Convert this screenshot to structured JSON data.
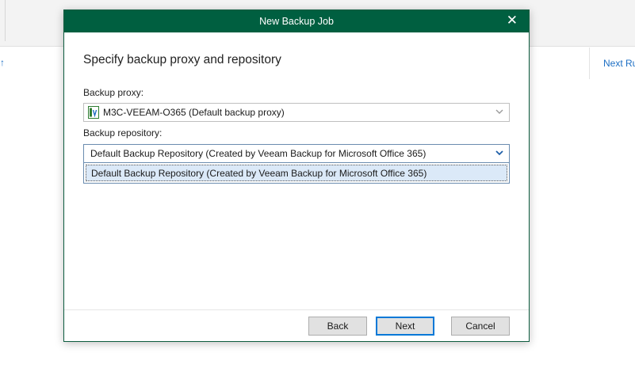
{
  "background": {
    "left_glyph": "↑",
    "column_header": "Next Ru"
  },
  "dialog": {
    "title": "New Backup Job",
    "close_glyph": "✕",
    "heading": "Specify backup proxy and repository",
    "proxy": {
      "label": "Backup proxy:",
      "value": "M3C-VEEAM-O365 (Default backup proxy)",
      "icon": "server-icon"
    },
    "repository": {
      "label": "Backup repository:",
      "value": "Default Backup Repository (Created by Veeam Backup for Microsoft Office 365)",
      "options": [
        "Default Backup Repository (Created by Veeam Backup for Microsoft Office 365)"
      ]
    },
    "buttons": {
      "back": "Back",
      "next": "Next",
      "cancel": "Cancel"
    }
  },
  "colors": {
    "titlebar": "#005f40",
    "selection": "#dbe9f8",
    "link": "#1c6fc4"
  }
}
